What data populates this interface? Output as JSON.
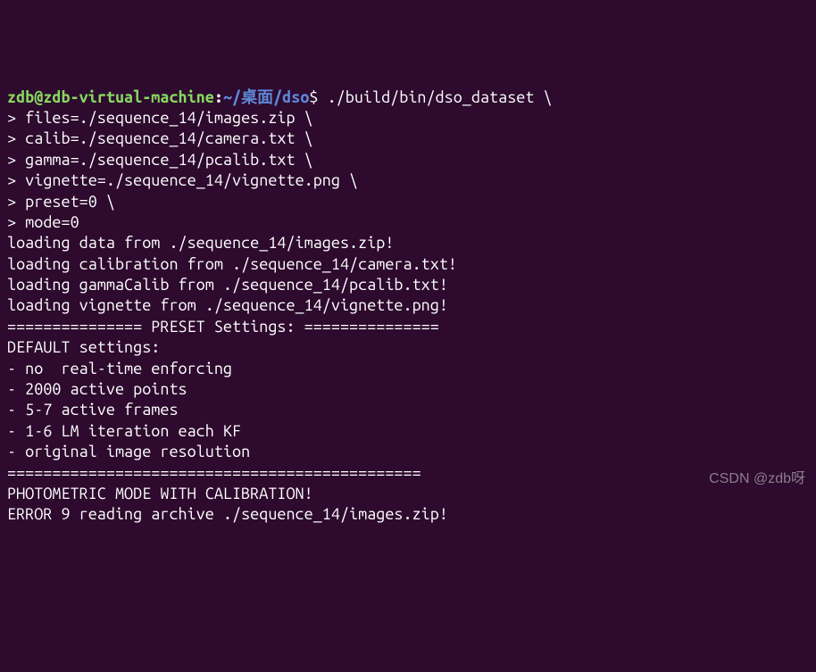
{
  "prompt": {
    "user_host": "zdb@zdb-virtual-machine",
    "colon": ":",
    "path": "~/桌面/dso",
    "dollar": "$"
  },
  "command": {
    "exec": " ./build/bin/dso_dataset \\",
    "cont_prefix": "> ",
    "args": [
      "files=./sequence_14/images.zip \\",
      "calib=./sequence_14/camera.txt \\",
      "gamma=./sequence_14/pcalib.txt \\",
      "vignette=./sequence_14/vignette.png \\",
      "preset=0 \\",
      "mode=0"
    ]
  },
  "output": {
    "loading": [
      "loading data from ./sequence_14/images.zip!",
      "loading calibration from ./sequence_14/camera.txt!",
      "loading gammaCalib from ./sequence_14/pcalib.txt!",
      "loading vignette from ./sequence_14/vignette.png!"
    ],
    "blank": "",
    "preset_header": "=============== PRESET Settings: ===============",
    "default_title": "DEFAULT settings:",
    "settings": [
      "- no  real-time enforcing",
      "- 2000 active points",
      "- 5-7 active frames",
      "- 1-6 LM iteration each KF",
      "- original image resolution"
    ],
    "divider": "==============================================",
    "photometric": "PHOTOMETRIC MODE WITH CALIBRATION!",
    "error": "ERROR 9 reading archive ./sequence_14/images.zip!"
  },
  "watermark": "CSDN @zdb呀"
}
